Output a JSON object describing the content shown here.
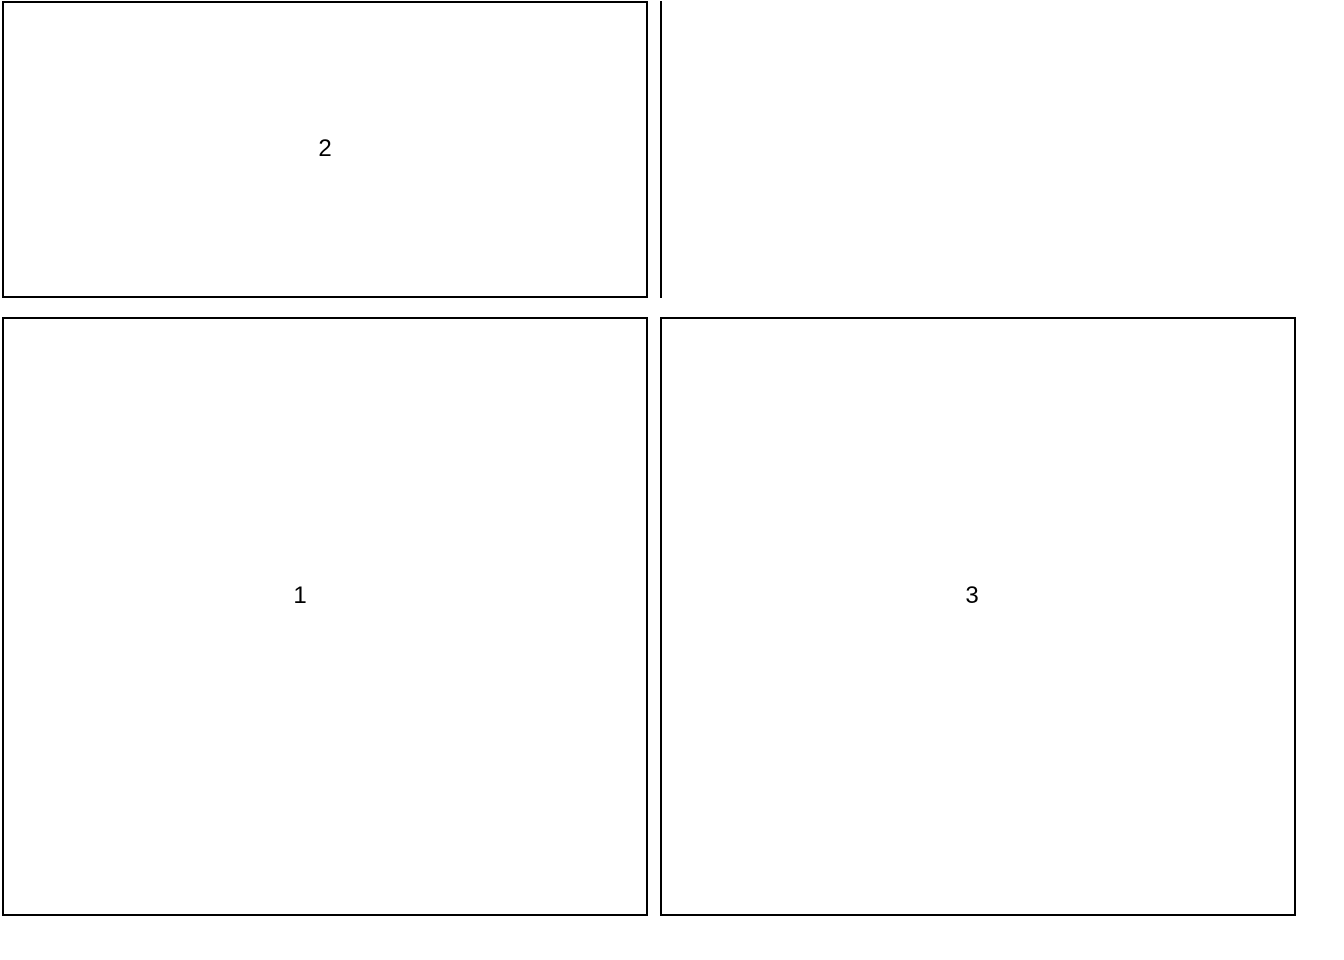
{
  "boxes": {
    "top_left": {
      "label": "2"
    },
    "bottom_left": {
      "label": "1"
    },
    "bottom_right": {
      "label": "3"
    }
  }
}
